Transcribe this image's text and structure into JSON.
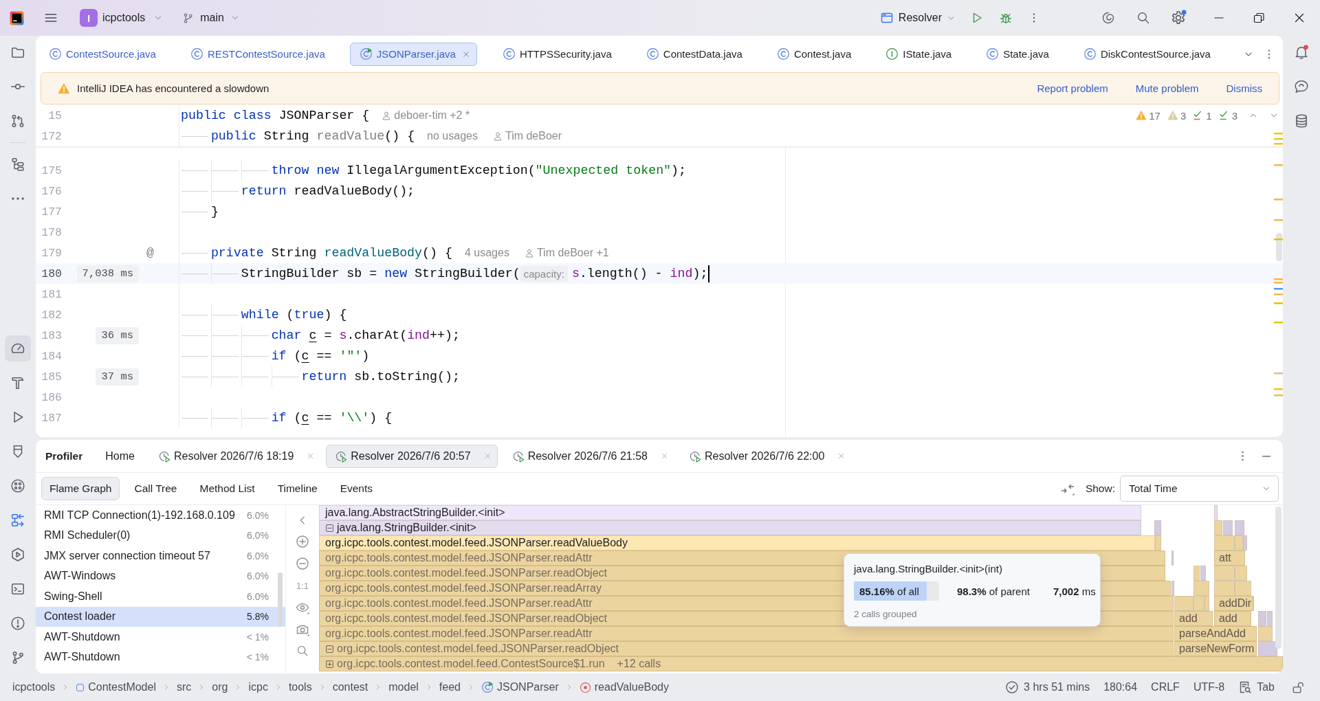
{
  "title_bar": {
    "project_badge": "I",
    "project": "icpctools",
    "branch": "main",
    "run_config": "Resolver",
    "settings_badge": true
  },
  "left_toolbar": {
    "top_groups": [
      [
        {
          "kind": "project",
          "selected": false
        },
        {
          "kind": "commit",
          "selected": false
        },
        {
          "kind": "pull-requests",
          "selected": false
        }
      ],
      [
        {
          "kind": "structure",
          "selected": false
        },
        {
          "kind": "more",
          "selected": false
        }
      ]
    ],
    "bottom": [
      {
        "kind": "profiler",
        "selected": true
      },
      {
        "kind": "build",
        "selected": false
      },
      {
        "kind": "run",
        "selected": false
      },
      {
        "kind": "bookmarks",
        "selected": false
      },
      {
        "kind": "services",
        "selected": false
      },
      {
        "kind": "deployment",
        "selected": false
      },
      {
        "kind": "run-dashboard",
        "selected": false
      },
      {
        "kind": "terminal",
        "selected": false
      },
      {
        "kind": "problems",
        "selected": false
      },
      {
        "kind": "git",
        "selected": false
      }
    ]
  },
  "right_toolbar": [
    {
      "kind": "notifications",
      "selected": false,
      "unread": true
    },
    {
      "kind": "ai-chat",
      "selected": false,
      "unread": false
    },
    {
      "kind": "database",
      "selected": false,
      "unread": false
    }
  ],
  "editor": {
    "tabs": [
      {
        "label": "ContestSource.java",
        "kind": "class",
        "modified": true,
        "selected": false
      },
      {
        "label": "RESTContestSource.java",
        "kind": "class",
        "modified": true,
        "selected": false
      },
      {
        "label": "JSONParser.java",
        "kind": "runnable-class",
        "modified": true,
        "selected": true
      },
      {
        "label": "HTTPSSecurity.java",
        "kind": "class",
        "modified": false,
        "selected": false
      },
      {
        "label": "ContestData.java",
        "kind": "class",
        "modified": false,
        "selected": false
      },
      {
        "label": "Contest.java",
        "kind": "class",
        "modified": false,
        "selected": false
      },
      {
        "label": "IState.java",
        "kind": "interface",
        "modified": false,
        "selected": false
      },
      {
        "label": "State.java",
        "kind": "class",
        "modified": false,
        "selected": false
      },
      {
        "label": "DiskContestSource.java",
        "kind": "class",
        "modified": false,
        "selected": false
      }
    ],
    "banner": {
      "message": "IntelliJ IDEA has encountered a slowdown",
      "actions": [
        "Report problem",
        "Mute problem",
        "Dismiss"
      ]
    },
    "inspections": [
      {
        "kind": "warning",
        "count": "17"
      },
      {
        "kind": "weak-warning",
        "count": "3"
      },
      {
        "kind": "typo",
        "count": "1"
      },
      {
        "kind": "grammar",
        "count": "3"
      }
    ],
    "sticky_lines": [
      {
        "number": "15",
        "parts": [
          {
            "kind": "code",
            "tokens": [
              {
                "kind": "keyword",
                "text": "public class "
              },
              {
                "kind": "plain",
                "text": "JSONParser {"
              }
            ]
          },
          {
            "kind": "author",
            "text": "deboer-tim +2 *"
          }
        ]
      },
      {
        "number": "172",
        "parts": [
          {
            "kind": "code",
            "tokens": [
              {
                "kind": "keyword",
                "text": "\tpublic "
              },
              {
                "kind": "plain",
                "text": "String "
              },
              {
                "kind": "unused",
                "text": "readValue"
              },
              {
                "kind": "plain",
                "text": "() {"
              }
            ]
          },
          {
            "kind": "usages",
            "text": "no usages"
          },
          {
            "kind": "author",
            "text": "Tim deBoer"
          }
        ]
      }
    ],
    "lines": [
      {
        "number": "175",
        "current": false,
        "parts": [
          {
            "kind": "code",
            "tokens": [
              {
                "kind": "keyword",
                "text": "\t\t\tthrow new "
              },
              {
                "kind": "plain",
                "text": "IllegalArgumentException("
              },
              {
                "kind": "string",
                "text": "\"Unexpected token\""
              },
              {
                "kind": "plain",
                "text": ");"
              }
            ]
          }
        ]
      },
      {
        "number": "176",
        "current": false,
        "parts": [
          {
            "kind": "code",
            "tokens": [
              {
                "kind": "keyword",
                "text": "\t\treturn "
              },
              {
                "kind": "plain",
                "text": "readValueBody();"
              }
            ]
          }
        ]
      },
      {
        "number": "177",
        "current": false,
        "parts": [
          {
            "kind": "code",
            "tokens": [
              {
                "kind": "plain",
                "text": "\t}"
              }
            ]
          }
        ]
      },
      {
        "number": "178",
        "current": false
      },
      {
        "number": "179",
        "current": false,
        "gutter_mark": "@",
        "parts": [
          {
            "kind": "code",
            "tokens": [
              {
                "kind": "keyword",
                "text": "\tprivate "
              },
              {
                "kind": "plain",
                "text": "String "
              },
              {
                "kind": "method",
                "text": "readValueBody"
              },
              {
                "kind": "plain",
                "text": "() {"
              }
            ]
          },
          {
            "kind": "usages",
            "text": "4 usages"
          },
          {
            "kind": "author",
            "text": "Tim deBoer +1"
          }
        ]
      },
      {
        "number": "180",
        "current": true,
        "timing": "7,038 ms",
        "parts": [
          {
            "kind": "code",
            "tokens": [
              {
                "kind": "plain",
                "text": "\t\tStringBuilder sb = "
              },
              {
                "kind": "keyword",
                "text": "new "
              },
              {
                "kind": "plain",
                "text": "StringBuilder("
              }
            ]
          },
          {
            "kind": "parameter",
            "text": "capacity:"
          },
          {
            "kind": "code",
            "tokens": [
              {
                "kind": "field",
                "text": "s"
              },
              {
                "kind": "plain",
                "text": ".length() - "
              },
              {
                "kind": "field",
                "text": "ind"
              },
              {
                "kind": "plain",
                "text": ");"
              }
            ]
          }
        ]
      },
      {
        "number": "181",
        "current": false
      },
      {
        "number": "182",
        "current": false,
        "parts": [
          {
            "kind": "code",
            "tokens": [
              {
                "kind": "keyword",
                "text": "\t\twhile "
              },
              {
                "kind": "plain",
                "text": "("
              },
              {
                "kind": "keyword",
                "text": "true"
              },
              {
                "kind": "plain",
                "text": ") {"
              }
            ]
          }
        ]
      },
      {
        "number": "183",
        "current": false,
        "timing": "36 ms",
        "parts": [
          {
            "kind": "code",
            "tokens": [
              {
                "kind": "keyword",
                "text": "\t\t\tchar "
              },
              {
                "kind": "local",
                "text": "c"
              },
              {
                "kind": "plain",
                "text": " = "
              },
              {
                "kind": "field",
                "text": "s"
              },
              {
                "kind": "plain",
                "text": ".charAt("
              },
              {
                "kind": "field",
                "text": "ind"
              },
              {
                "kind": "plain",
                "text": "++);"
              }
            ]
          }
        ]
      },
      {
        "number": "184",
        "current": false,
        "parts": [
          {
            "kind": "code",
            "tokens": [
              {
                "kind": "keyword",
                "text": "\t\t\tif "
              },
              {
                "kind": "plain",
                "text": "("
              },
              {
                "kind": "local",
                "text": "c"
              },
              {
                "kind": "plain",
                "text": " == "
              },
              {
                "kind": "string",
                "text": "'\"'"
              },
              {
                "kind": "plain",
                "text": ")"
              }
            ]
          }
        ]
      },
      {
        "number": "185",
        "current": false,
        "timing": "37 ms",
        "parts": [
          {
            "kind": "code",
            "tokens": [
              {
                "kind": "keyword",
                "text": "\t\t\t\treturn "
              },
              {
                "kind": "plain",
                "text": "sb.toString();"
              }
            ]
          }
        ]
      },
      {
        "number": "186",
        "current": false
      },
      {
        "number": "187",
        "current": false,
        "parts": [
          {
            "kind": "code",
            "tokens": [
              {
                "kind": "keyword",
                "text": "\t\t\tif "
              },
              {
                "kind": "plain",
                "text": "("
              },
              {
                "kind": "local",
                "text": "c"
              },
              {
                "kind": "plain",
                "text": " == "
              },
              {
                "kind": "string",
                "text": "'\\\\'"
              },
              {
                "kind": "plain",
                "text": ") {"
              }
            ]
          }
        ]
      }
    ]
  },
  "profiler": {
    "title": "Profiler",
    "tabs": [
      {
        "label": "Home",
        "kind": "home",
        "selected": false
      },
      {
        "label": "Resolver 2026/7/6 18:19",
        "kind": "snapshot",
        "selected": false
      },
      {
        "label": "Resolver 2026/7/6 20:57",
        "kind": "snapshot",
        "selected": true
      },
      {
        "label": "Resolver 2026/7/6 21:58",
        "kind": "snapshot",
        "selected": false
      },
      {
        "label": "Resolver 2026/7/6 22:00",
        "kind": "snapshot",
        "selected": false
      }
    ],
    "views": [
      {
        "label": "Flame Graph",
        "selected": true
      },
      {
        "label": "Call Tree",
        "selected": false
      },
      {
        "label": "Method List",
        "selected": false
      },
      {
        "label": "Timeline",
        "selected": false
      },
      {
        "label": "Events",
        "selected": false
      }
    ],
    "show": {
      "label": "Show:",
      "value": "Total Time"
    },
    "threads": [
      {
        "name": "RMI TCP Connection(1)-192.168.0.109",
        "share": "6.0%",
        "selected": false
      },
      {
        "name": "RMI Scheduler(0)",
        "share": "6.0%",
        "selected": false
      },
      {
        "name": "JMX server connection timeout 57",
        "share": "6.0%",
        "selected": false
      },
      {
        "name": "AWT-Windows",
        "share": "6.0%",
        "selected": false
      },
      {
        "name": "Swing-Shell",
        "share": "6.0%",
        "selected": false
      },
      {
        "name": "Contest loader",
        "share": "5.8%",
        "selected": true
      },
      {
        "name": "AWT-Shutdown",
        "share": "< 1%",
        "selected": false
      },
      {
        "name": "AWT-Shutdown",
        "share": "< 1%",
        "selected": false
      }
    ],
    "flame_graph": {
      "actual_size": "1:1",
      "frames": [
        {
          "label": "java.lang.AbstractStringBuilder.<init>",
          "color": "#efe8fb",
          "dimmed": false
        },
        {
          "label": "java.lang.StringBuilder.<init>",
          "color": "#e3dcef",
          "dimmed": false,
          "expanded": true
        },
        {
          "label": "org.icpc.tools.contest.model.feed.JSONParser.readValueBody",
          "color": "#fde8b4",
          "dimmed": false
        },
        {
          "label": "org.icpc.tools.contest.model.feed.JSONParser.readAttr",
          "color": "#ecd49f",
          "dimmed": true
        },
        {
          "label": "org.icpc.tools.contest.model.feed.JSONParser.readObject",
          "color": "#ecd49f",
          "dimmed": true
        },
        {
          "label": "org.icpc.tools.contest.model.feed.JSONParser.readArray",
          "color": "#ecd49f",
          "dimmed": true
        },
        {
          "label": "org.icpc.tools.contest.model.feed.JSONParser.readAttr",
          "color": "#ecd49f",
          "dimmed": true
        },
        {
          "label": "org.icpc.tools.contest.model.feed.JSONParser.readObject",
          "color": "#ecd49f",
          "dimmed": true
        },
        {
          "label": "org.icpc.tools.contest.model.feed.JSONParser.readAttr",
          "color": "#ecd49f",
          "dimmed": true
        },
        {
          "label": "org.icpc.tools.contest.model.feed.JSONParser.readObject",
          "color": "#ecd49f",
          "dimmed": true,
          "expanded": true
        },
        {
          "label": "org.icpc.tools.contest.model.feed.ContestSource$1.run",
          "calls": "+12 calls",
          "color": "#ecd49f",
          "dimmed": true,
          "expanded": false
        }
      ],
      "side_frames": [
        {
          "label": "att"
        },
        {
          "label": "addDir"
        },
        {
          "label": "add"
        },
        {
          "label": "add"
        },
        {
          "label": "parseAndAdd"
        },
        {
          "label": "parseNewForm"
        }
      ]
    },
    "tooltip": {
      "title": "java.lang.StringBuilder.<init>(int)",
      "of_all": "**85.16%** of all",
      "level": 0.8516,
      "of_parent": "**98.3%** of parent",
      "time": "**7,002** ms",
      "note": "2 calls grouped"
    }
  },
  "status_bar": {
    "breadcrumbs": [
      {
        "label": "icpctools",
        "kind": "project"
      },
      {
        "label": "ContestModel",
        "kind": "module"
      },
      {
        "label": "src",
        "kind": "folder"
      },
      {
        "label": "org",
        "kind": "package"
      },
      {
        "label": "icpc",
        "kind": "package"
      },
      {
        "label": "tools",
        "kind": "package"
      },
      {
        "label": "contest",
        "kind": "package"
      },
      {
        "label": "model",
        "kind": "package"
      },
      {
        "label": "feed",
        "kind": "package"
      },
      {
        "label": "JSONParser",
        "kind": "class"
      },
      {
        "label": "readValueBody",
        "kind": "method"
      }
    ],
    "widgets": [
      {
        "kind": "time",
        "text": "3 hrs 51 mins"
      },
      {
        "kind": "position",
        "text": "180:64"
      },
      {
        "kind": "line-separator",
        "text": "CRLF"
      },
      {
        "kind": "encoding",
        "text": "UTF-8"
      },
      {
        "kind": "indent",
        "text": "Tab"
      }
    ],
    "locked": false
  }
}
